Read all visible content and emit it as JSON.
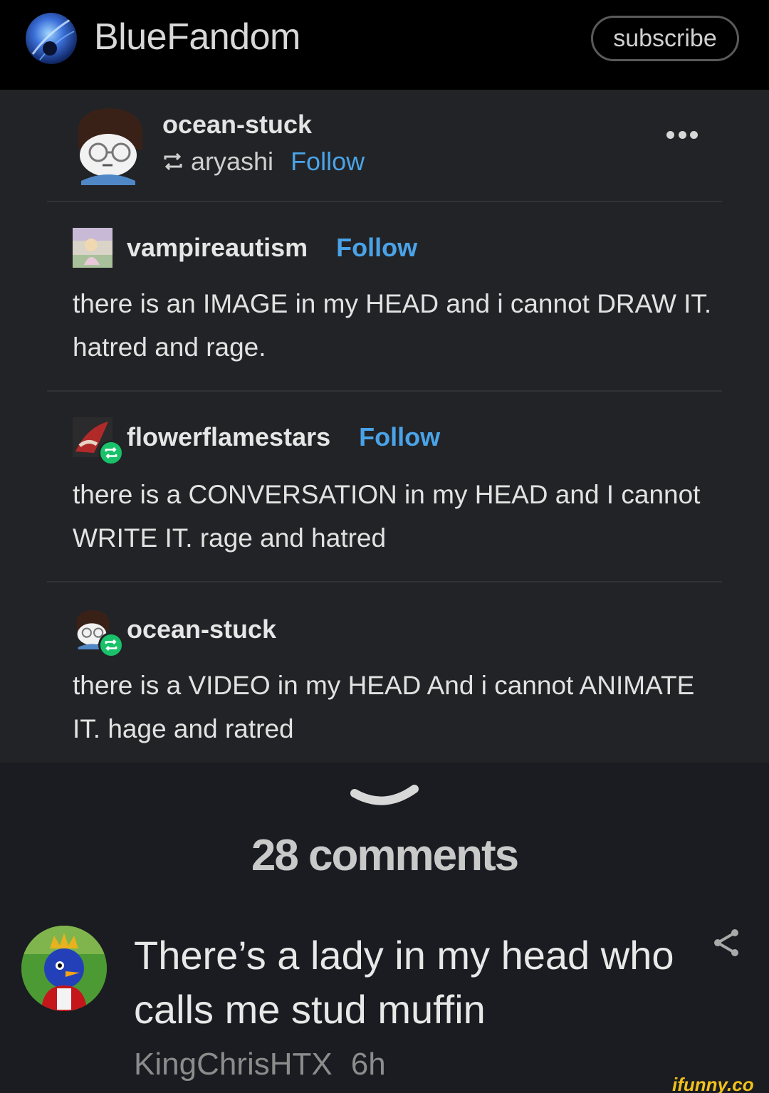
{
  "header": {
    "title": "BlueFandom",
    "subscribe_label": "subscribe"
  },
  "post": {
    "op": {
      "name": "ocean-stuck",
      "reblogged_from": "aryashi",
      "follow_label": "Follow"
    },
    "entries": [
      {
        "name": "vampireautism",
        "follow_label": "Follow",
        "text": "there is an IMAGE in my HEAD and i cannot DRAW IT. hatred and rage."
      },
      {
        "name": "flowerflamestars",
        "follow_label": "Follow",
        "text": "there is a CONVERSATION in my HEAD and I cannot WRITE IT. rage and hatred"
      },
      {
        "name": "ocean-stuck",
        "text": "there is a VIDEO in my HEAD And i cannot ANIMATE IT. hage and ratred"
      }
    ]
  },
  "comments": {
    "count_label": "28 comments",
    "items": [
      {
        "text": "There’s a lady in my head who calls me stud muffin",
        "author": "KingChrisHTX",
        "time": "6h"
      }
    ]
  },
  "watermark": "ifunny.co",
  "colors": {
    "header_bg": "#000000",
    "post_bg": "#222326",
    "page_bg": "#1b1c21",
    "follow_blue": "#4aa3e8",
    "reblog_green": "#19c16a",
    "watermark_yellow": "#f1c21b"
  }
}
